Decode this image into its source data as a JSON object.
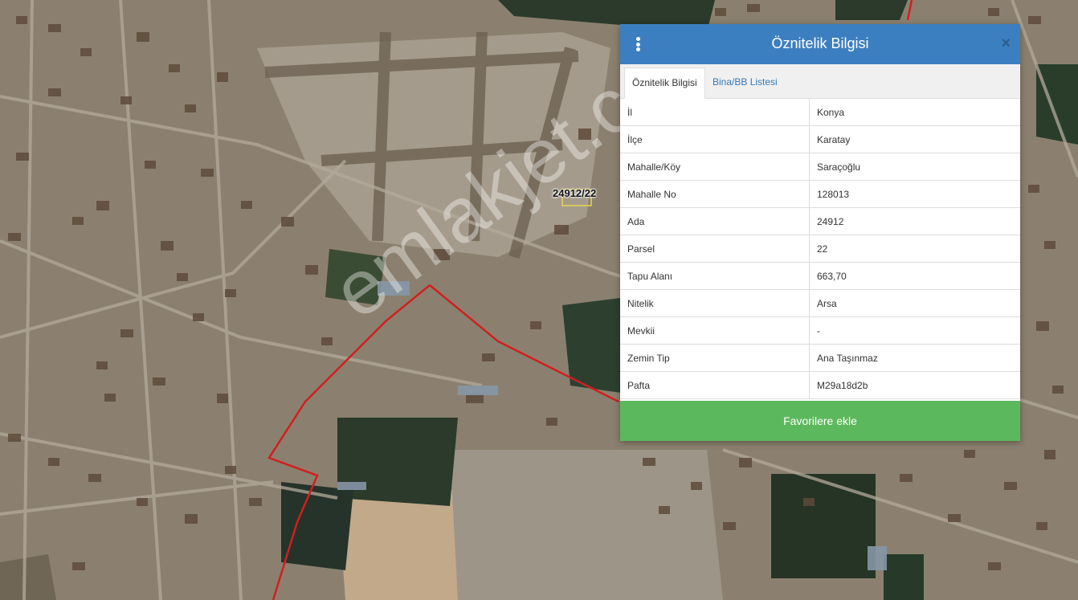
{
  "map": {
    "parcel_label": "24912/22",
    "watermark": "emlakjet.com",
    "parcel_outline_color": "#d11f1f"
  },
  "panel": {
    "title": "Öznitelik Bilgisi",
    "menu_icon": "vertical-dots-icon",
    "close_icon": "close-icon",
    "close_glyph": "×",
    "header_color": "#3c7fc0",
    "tabs": [
      {
        "label": "Öznitelik Bilgisi",
        "active": true
      },
      {
        "label": "Bina/BB Listesi",
        "active": false
      }
    ],
    "rows": [
      {
        "key": "İl",
        "value": "Konya"
      },
      {
        "key": "İlçe",
        "value": "Karatay"
      },
      {
        "key": "Mahalle/Köy",
        "value": "Saraçoğlu"
      },
      {
        "key": "Mahalle No",
        "value": "128013"
      },
      {
        "key": "Ada",
        "value": "24912"
      },
      {
        "key": "Parsel",
        "value": "22"
      },
      {
        "key": "Tapu Alanı",
        "value": "663,70"
      },
      {
        "key": "Nitelik",
        "value": "Arsa"
      },
      {
        "key": "Mevkii",
        "value": "-"
      },
      {
        "key": "Zemin Tip",
        "value": "Ana Taşınmaz"
      },
      {
        "key": "Pafta",
        "value": "M29a18d2b"
      }
    ],
    "favorite_button": "Favorilere ekle",
    "favorite_color": "#5cb85c"
  }
}
